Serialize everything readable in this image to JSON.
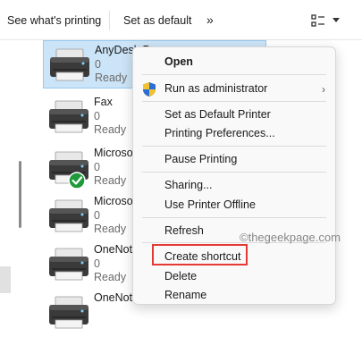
{
  "toolbar": {
    "see_printing": "See what's printing",
    "set_default": "Set as default",
    "more": "»",
    "view_icon": "view-options-icon",
    "dropdown_icon": "chevron-down-icon"
  },
  "printers": [
    {
      "name": "AnyDesk Pr",
      "count": "0",
      "status": "Ready",
      "selected": true,
      "default_check": false
    },
    {
      "name": "Fax",
      "count": "0",
      "status": "Ready",
      "selected": false,
      "default_check": false
    },
    {
      "name": "Microso",
      "count": "0",
      "status": "Ready",
      "selected": false,
      "default_check": true
    },
    {
      "name": "Microso",
      "count": "0",
      "status": "Ready",
      "selected": false,
      "default_check": false
    },
    {
      "name": "OneNot",
      "count": "0",
      "status": "Ready",
      "selected": false,
      "default_check": false
    },
    {
      "name": "OneNot",
      "count": "",
      "status": "",
      "selected": false,
      "default_check": false
    }
  ],
  "context_menu": {
    "open": "Open",
    "run_as_admin": "Run as administrator",
    "set_default_printer": "Set as Default Printer",
    "printing_preferences": "Printing Preferences...",
    "pause_printing": "Pause Printing",
    "sharing": "Sharing...",
    "use_offline": "Use Printer Offline",
    "refresh": "Refresh",
    "create_shortcut": "Create shortcut",
    "delete": "Delete",
    "rename": "Rename",
    "submenu_arrow": "›"
  },
  "watermark": "©thegeekpage.com",
  "colors": {
    "selection": "#cce4f7",
    "highlight_box": "#e53935",
    "check_green": "#1f9a3a"
  }
}
